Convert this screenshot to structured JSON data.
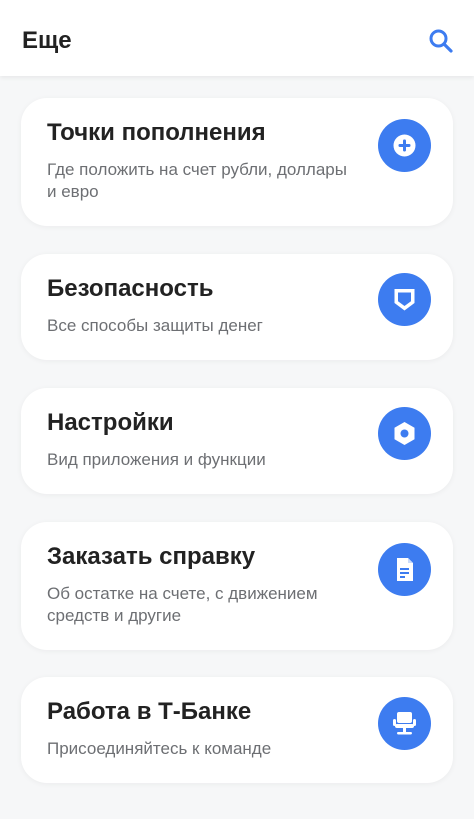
{
  "header": {
    "title": "Еще",
    "search_icon": "search-icon"
  },
  "colors": {
    "accent": "#3d7cf0",
    "title_text": "#222222",
    "desc_text": "#6d6f73",
    "background": "#f6f7f8"
  },
  "cards": [
    {
      "title": "Точки пополнения",
      "description": "Где положить на счет рубли, доллары и евро",
      "icon": "plus-icon"
    },
    {
      "title": "Безопасность",
      "description": "Все способы защиты денег",
      "icon": "shield-icon"
    },
    {
      "title": "Настройки",
      "description": "Вид приложения и функции",
      "icon": "gear-icon"
    },
    {
      "title": "Заказать справку",
      "description": "Об остатке на счете, с движением средств и другие",
      "icon": "document-icon"
    },
    {
      "title": "Работа в Т‑Банке",
      "description": "Присоединяйтесь к команде",
      "icon": "chair-icon"
    }
  ]
}
